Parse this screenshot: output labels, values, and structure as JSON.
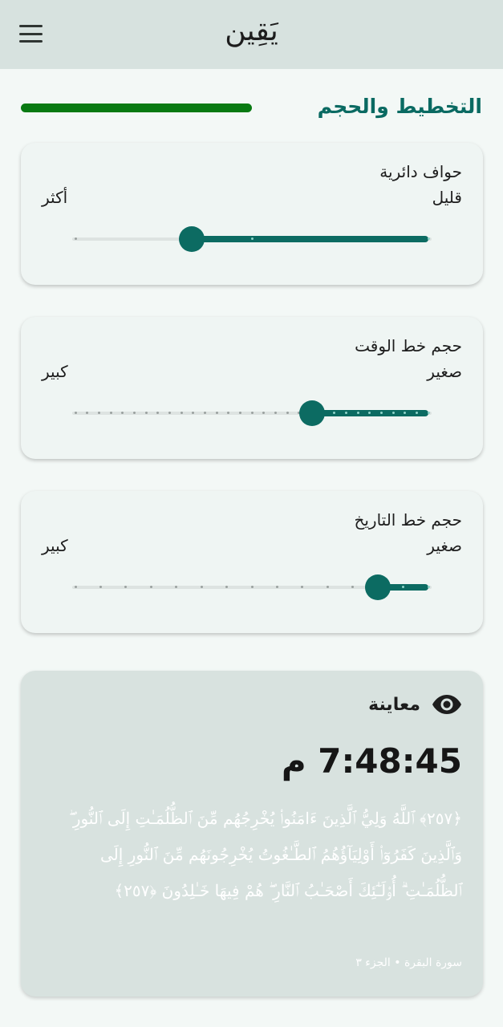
{
  "app_bar": {
    "title": "يَقِين",
    "menu_icon": "hamburger-menu-icon"
  },
  "section": {
    "title": "التخطيط والحجم",
    "accent_color": "#087a12"
  },
  "sliders": [
    {
      "label": "حواف دائرية",
      "min_label": "قليل",
      "max_label": "أكثر",
      "divisions": 2,
      "value_fraction": 0.67
    },
    {
      "label": "حجم خط الوقت",
      "min_label": "صغير",
      "max_label": "كبير",
      "divisions": 30,
      "value_fraction": 0.33
    },
    {
      "label": "حجم خط التاريخ",
      "min_label": "صغير",
      "max_label": "كبير",
      "divisions": 14,
      "value_fraction": 0.143
    }
  ],
  "preview": {
    "label": "معاينة",
    "icon": "eye-icon",
    "time": "7:48:45 م",
    "verse": "﴿٢٥٧﴾ ٱللَّهُ وَلِيُّ ٱلَّذِينَ ءَامَنُوا۟ يُخْرِجُهُم مِّنَ ٱلظُّلُمَـٰتِ إِلَى ٱلنُّورِ ۖ وَٱلَّذِينَ كَفَرُوٓا۟ أَوْلِيَآؤُهُمُ ٱلطَّـٰغُوتُ يُخْرِجُونَهُم مِّنَ ٱلنُّورِ إِلَى ٱلظُّلُمَـٰتِ ۗ أُو۟لَـٰٓئِكَ أَصْحَـٰبُ ٱلنَّارِ ۖ هُمْ فِيهَا خَـٰلِدُونَ ﴿٢٥٧﴾",
    "reference": "سورة البقرة • الجزء ٣"
  },
  "colors": {
    "primary": "#0c6b62",
    "track": "#dde3e1",
    "top_bar": "#d7e2df",
    "card": "#eff5f3",
    "preview_bg": "#d8e2df"
  }
}
